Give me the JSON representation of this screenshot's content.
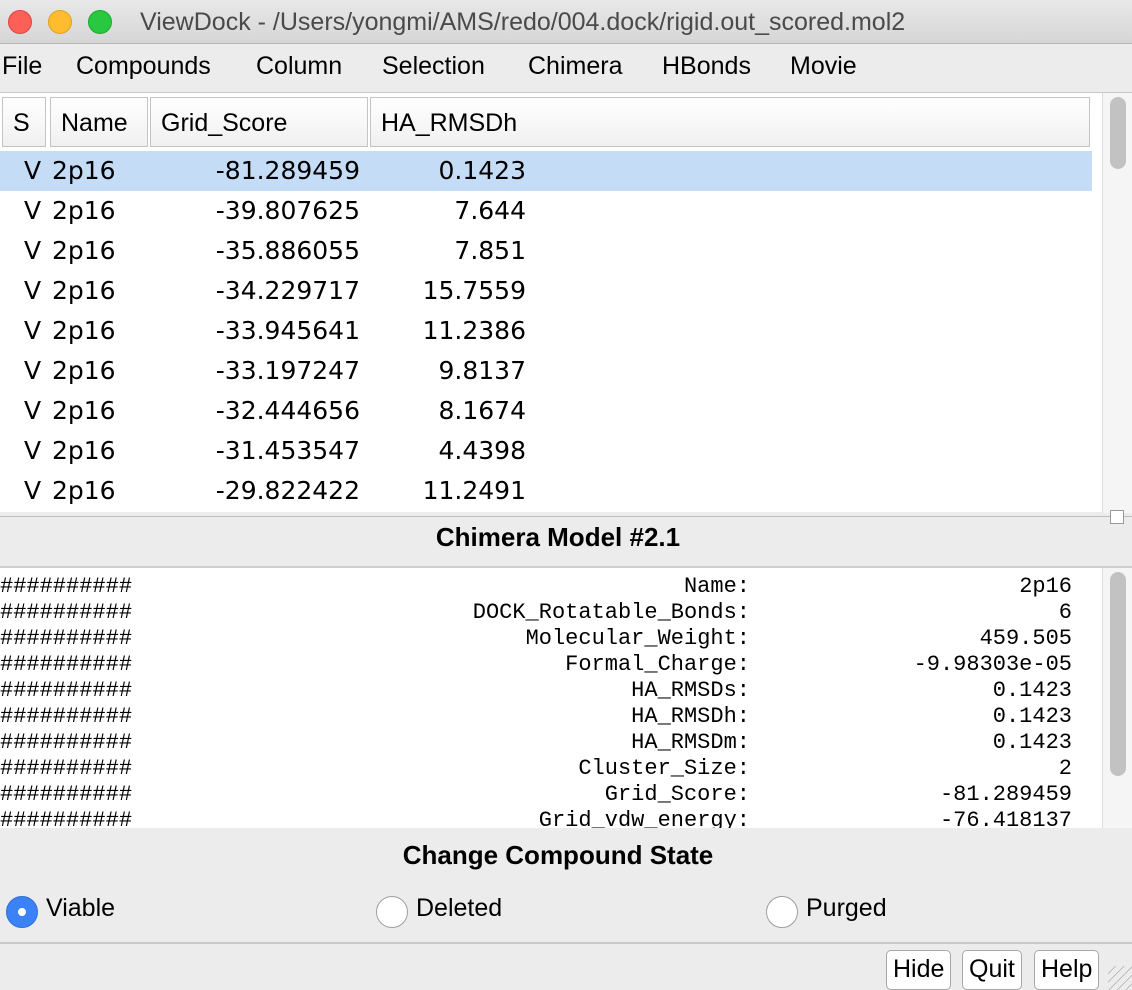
{
  "window": {
    "title": "ViewDock - /Users/yongmi/AMS/redo/004.dock/rigid.out_scored.mol2"
  },
  "menu": [
    "File",
    "Compounds",
    "Column",
    "Selection",
    "Chimera",
    "HBonds",
    "Movie"
  ],
  "table": {
    "columns": [
      "S",
      "Name",
      "Grid_Score",
      "HA_RMSDh"
    ],
    "rows": [
      {
        "s": "V",
        "name": "2p16",
        "grid_score": "-81.289459",
        "ha_rmsdh": "0.1423",
        "selected": true
      },
      {
        "s": "V",
        "name": "2p16",
        "grid_score": "-39.807625",
        "ha_rmsdh": "7.644"
      },
      {
        "s": "V",
        "name": "2p16",
        "grid_score": "-35.886055",
        "ha_rmsdh": "7.851"
      },
      {
        "s": "V",
        "name": "2p16",
        "grid_score": "-34.229717",
        "ha_rmsdh": "15.7559"
      },
      {
        "s": "V",
        "name": "2p16",
        "grid_score": "-33.945641",
        "ha_rmsdh": "11.2386"
      },
      {
        "s": "V",
        "name": "2p16",
        "grid_score": "-33.197247",
        "ha_rmsdh": "9.8137"
      },
      {
        "s": "V",
        "name": "2p16",
        "grid_score": "-32.444656",
        "ha_rmsdh": "8.1674"
      },
      {
        "s": "V",
        "name": "2p16",
        "grid_score": "-31.453547",
        "ha_rmsdh": "4.4398"
      },
      {
        "s": "V",
        "name": "2p16",
        "grid_score": "-29.822422",
        "ha_rmsdh": "11.2491"
      }
    ]
  },
  "detail": {
    "heading": "Chimera Model #2.1",
    "hash_prefix": "##########",
    "rows": [
      {
        "label": "Name:",
        "value": "2p16"
      },
      {
        "label": "DOCK_Rotatable_Bonds:",
        "value": "6"
      },
      {
        "label": "Molecular_Weight:",
        "value": "459.505"
      },
      {
        "label": "Formal_Charge:",
        "value": "-9.98303e-05"
      },
      {
        "label": "HA_RMSDs:",
        "value": "0.1423"
      },
      {
        "label": "HA_RMSDh:",
        "value": "0.1423"
      },
      {
        "label": "HA_RMSDm:",
        "value": "0.1423"
      },
      {
        "label": "Cluster_Size:",
        "value": "2"
      },
      {
        "label": "Grid_Score:",
        "value": "-81.289459"
      },
      {
        "label": "Grid_vdw_energy:",
        "value": "-76.418137"
      }
    ]
  },
  "state": {
    "heading": "Change Compound State",
    "options": [
      {
        "label": "Viable",
        "selected": true
      },
      {
        "label": "Deleted",
        "selected": false
      },
      {
        "label": "Purged",
        "selected": false
      }
    ]
  },
  "buttons": {
    "hide": "Hide",
    "quit": "Quit",
    "help": "Help"
  },
  "colors": {
    "selection": "#c5dcf6",
    "radio_accent": "#3b82f6"
  }
}
